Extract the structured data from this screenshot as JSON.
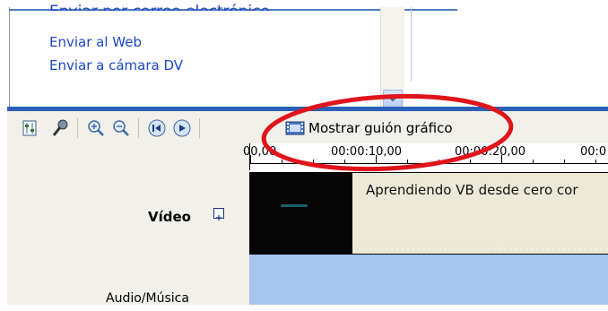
{
  "task_pane": {
    "cut_link": "Enviar por correo electrónico",
    "links": [
      "Enviar al Web",
      "Enviar a cámara DV"
    ]
  },
  "toolbar": {
    "storyboard_label": "Mostrar guión gráfico",
    "icons": [
      "set-audio-levels-icon",
      "narrate-timeline-icon",
      "zoom-in-icon",
      "zoom-out-icon",
      "rewind-icon",
      "play-icon",
      "storyboard-icon"
    ]
  },
  "ruler": {
    "ticks": [
      "00,00",
      "00:00:10,00",
      "00:00:20,00",
      "00:0"
    ]
  },
  "tracks": {
    "video_label": "Vídeo",
    "audio_label": "Audio/Música",
    "clip_title": "Aprendiendo VB desde cero cor"
  },
  "colors": {
    "link": "#1b46c2",
    "annotation": "#e0141b",
    "audio_track": "#a6c5ef",
    "clip_bg": "#ece9d8"
  }
}
